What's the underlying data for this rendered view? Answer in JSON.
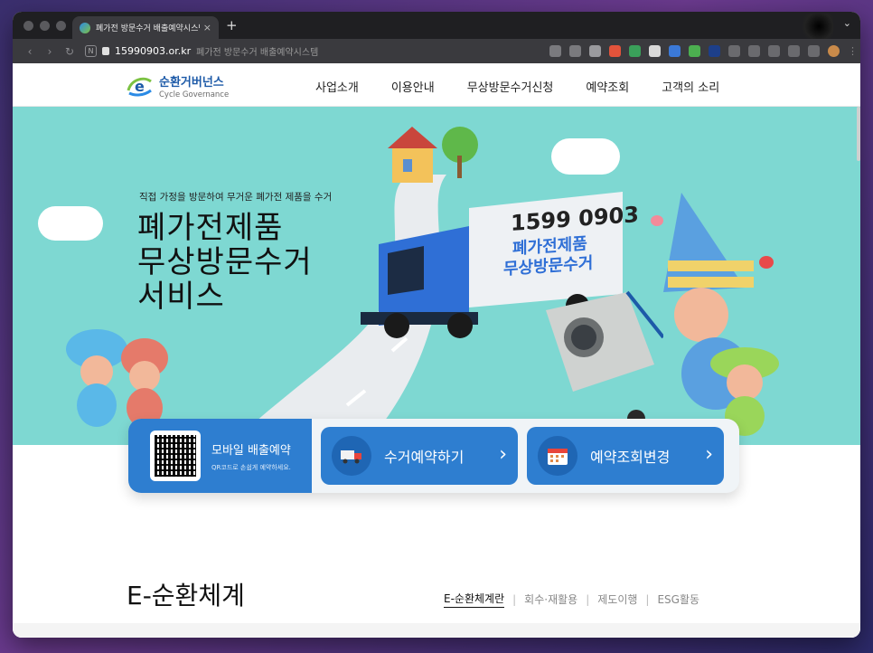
{
  "browser": {
    "tab_title": "폐가전 방문수거 배출예약시스템",
    "new_tab": "+",
    "host": "15990903.or.kr",
    "path_title": "폐가전 방문수거 배출예약시스템",
    "menu_chevron": "⌄",
    "back": "‹",
    "forward": "›",
    "reload": "↻",
    "home": "N"
  },
  "site": {
    "logo_ko": "순환거버넌스",
    "logo_en": "Cycle Governance",
    "nav": [
      "사업소개",
      "이용안내",
      "무상방문수거신청",
      "예약조회",
      "고객의 소리"
    ]
  },
  "hero": {
    "subtitle": "직접 가정을 방문하여 무거운 폐가전 제품을 수거",
    "title_line1": "폐가전제품",
    "title_line2": "무상방문수거",
    "title_line3": "서비스",
    "truck_phone": "1599 0903",
    "truck_line1": "폐가전제품",
    "truck_line2": "무상방문수거"
  },
  "quick": {
    "mobile_title": "모바일 배출예약",
    "mobile_sub": "QR코드로 손쉽게 예약하세요.",
    "reserve_label": "수거예약하기",
    "lookup_label": "예약조회변경",
    "arrow": "›"
  },
  "section": {
    "title": "E-순환체계",
    "tabs": [
      "E-순환체계란",
      "회수·재활용",
      "제도이행",
      "ESG활동"
    ],
    "separator": "|"
  },
  "colors": {
    "hero_bg": "#7ed8d2",
    "brand_blue": "#2e7ed0",
    "truck_blue": "#2f6fd6"
  }
}
